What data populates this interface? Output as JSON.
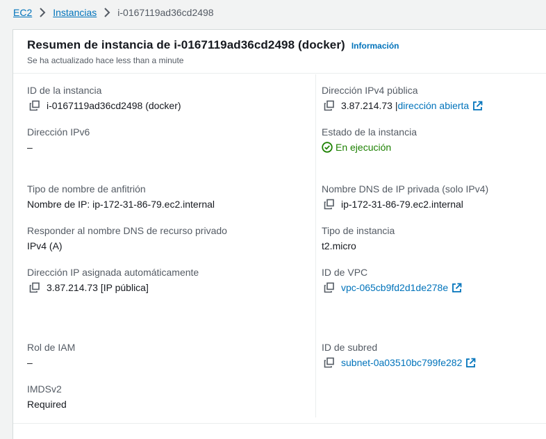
{
  "breadcrumb": {
    "items": [
      {
        "label": "EC2"
      },
      {
        "label": "Instancias"
      },
      {
        "label": "i-0167119ad36cd2498"
      }
    ]
  },
  "header": {
    "title": "Resumen de instancia de i-0167119ad36cd2498 (docker)",
    "info_link": "Información",
    "subtitle": "Se ha actualizado hace less than a minute"
  },
  "fields": {
    "instance_id": {
      "label": "ID de la instancia",
      "value": "i-0167119ad36cd2498 (docker)"
    },
    "public_ipv4": {
      "label": "Dirección IPv4 pública",
      "value": "3.87.214.73 |",
      "link": "dirección abierta"
    },
    "ipv6": {
      "label": "Dirección IPv6",
      "value": "–"
    },
    "instance_state": {
      "label": "Estado de la instancia",
      "value": "En ejecución"
    },
    "hostname_type": {
      "label": "Tipo de nombre de anfitrión",
      "value": "Nombre de IP: ip-172-31-86-79.ec2.internal"
    },
    "private_dns": {
      "label": "Nombre DNS de IP privada (solo IPv4)",
      "value": "ip-172-31-86-79.ec2.internal"
    },
    "resource_dns": {
      "label": "Responder al nombre DNS de recurso privado",
      "value": "IPv4 (A)"
    },
    "instance_type": {
      "label": "Tipo de instancia",
      "value": "t2.micro"
    },
    "auto_ip": {
      "label": "Dirección IP asignada automáticamente",
      "value": "3.87.214.73 [IP pública]"
    },
    "vpc_id": {
      "label": "ID de VPC",
      "value": "vpc-065cb9fd2d1de278e"
    },
    "iam_role": {
      "label": "Rol de IAM",
      "value": "–"
    },
    "subnet_id": {
      "label": "ID de subred",
      "value": "subnet-0a03510bc799fe282"
    },
    "imdsv2": {
      "label": "IMDSv2",
      "value": "Required"
    }
  },
  "icons": {
    "copy": "copy-icon",
    "external": "external-link-icon",
    "status": "check-circle-icon",
    "separator": "chevron-right-icon"
  },
  "colors": {
    "link": "#0073bb",
    "success": "#1d8102",
    "label": "#545b64",
    "text": "#16191f",
    "background": "#f2f3f3"
  }
}
